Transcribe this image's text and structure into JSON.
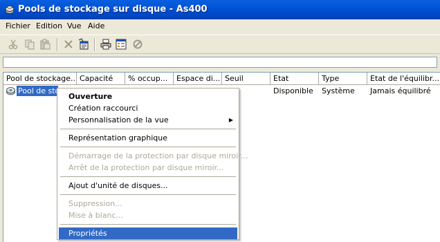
{
  "window": {
    "title": "Pools de stockage sur disque - As400"
  },
  "menubar": {
    "items": [
      "Fichier",
      "Edition",
      "Vue",
      "Aide"
    ]
  },
  "toolbar": {
    "buttons": [
      "cut-icon",
      "copy-icon",
      "paste-icon",
      "delete-icon",
      "properties-icon",
      "print-icon",
      "view-icon",
      "stop-icon"
    ]
  },
  "list": {
    "columns": [
      "Pool de stockage...",
      "Capacité",
      "% occup...",
      "Espace di...",
      "Seuil",
      "Etat",
      "Type",
      "Etat de l'équilibr..."
    ],
    "rows": [
      {
        "name": "Pool de stockage",
        "etat": "Disponible",
        "type": "Système",
        "equilibre": "Jamais équilibré"
      }
    ]
  },
  "context_menu": {
    "items": [
      "Ouverture",
      "Création raccourci",
      "Personnalisation de la vue",
      "Représentation graphique",
      "Démarrage de la protection par disque miroir...",
      "Arrêt de la protection par disque miroir...",
      "Ajout d'unité de disques...",
      "Suppression...",
      "Mise à blanc...",
      "Propriétés"
    ]
  }
}
